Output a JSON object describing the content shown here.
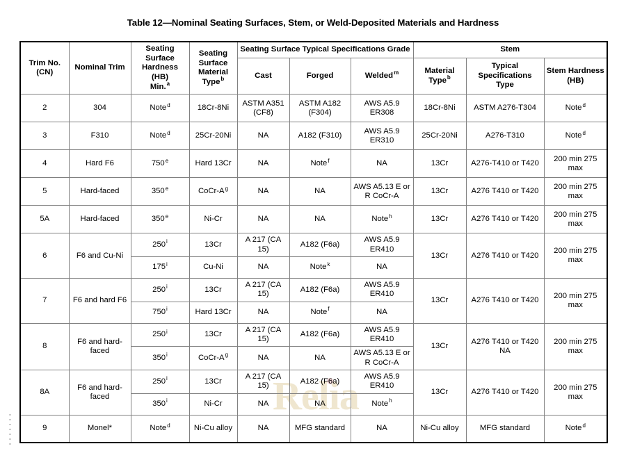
{
  "document": {
    "title": "Table 12—Nominal Seating Surfaces, Stem, or Weld-Deposited Materials and Hardness",
    "watermark": "Relia"
  },
  "table": {
    "header": {
      "group_seating_surface_specs": "Seating Surface Typical Specifications Grade",
      "group_stem": "Stem",
      "trim_no": "Trim No. (CN)",
      "trim_no_line1": "Trim No.",
      "trim_no_line2": "(CN)",
      "nominal_trim": "Nominal Trim",
      "seating_hardness_line1": "Seating",
      "seating_hardness_line2": "Surface",
      "seating_hardness_line3": "Hardness (HB)",
      "seating_hardness_line4": "Min.",
      "seating_hardness_sup": "a",
      "seating_material_line1": "Seating",
      "seating_material_line2": "Surface",
      "seating_material_line3": "Material",
      "seating_material_line4": "Type",
      "seating_material_sup": "b",
      "cast": "Cast",
      "forged": "Forged",
      "welded": "Welded",
      "welded_sup": "m",
      "stem_material_line1": "Material",
      "stem_material_line2": "Type",
      "stem_material_sup": "b",
      "stem_typical_line1": "Typical",
      "stem_typical_line2": "Specifications",
      "stem_typical_line3": "Type",
      "stem_hardness_line1": "Stem Hardness",
      "stem_hardness_line2": "(HB)"
    },
    "rows": [
      {
        "trim_no": "2",
        "nominal_trim": "304",
        "hardness": "Note",
        "hardness_sup": "d",
        "material": "18Cr-8Ni",
        "cast": "ASTM A351 (CF8)",
        "forged": "ASTM A182 (F304)",
        "welded": "AWS A5.9 ER308",
        "stem_material": "18Cr-8Ni",
        "stem_spec": "ASTM A276-T304",
        "stem_hardness": "Note",
        "stem_hardness_sup": "d"
      },
      {
        "trim_no": "3",
        "nominal_trim": "F310",
        "hardness": "Note",
        "hardness_sup": "d",
        "material": "25Cr-20Ni",
        "cast": "NA",
        "forged": "A182 (F310)",
        "welded": "AWS A5.9 ER310",
        "stem_material": "25Cr-20Ni",
        "stem_spec": "A276-T310",
        "stem_hardness": "Note",
        "stem_hardness_sup": "d"
      },
      {
        "trim_no": "4",
        "nominal_trim": "Hard F6",
        "hardness": "750",
        "hardness_sup": "e",
        "material": "Hard 13Cr",
        "cast": "NA",
        "forged": "Note",
        "forged_sup": "f",
        "welded": "NA",
        "stem_material": "13Cr",
        "stem_spec": "A276-T410 or T420",
        "stem_hardness": "200 min 275 max"
      },
      {
        "trim_no": "5",
        "nominal_trim": "Hard-faced",
        "hardness": "350",
        "hardness_sup": "e",
        "material": "CoCr-A",
        "material_sup": "g",
        "cast": "NA",
        "forged": "NA",
        "welded": "AWS A5.13 E or R CoCr-A",
        "stem_material": "13Cr",
        "stem_spec": "A276 T410 or T420",
        "stem_hardness": "200 min 275 max"
      },
      {
        "trim_no": "5A",
        "nominal_trim": "Hard-faced",
        "hardness": "350",
        "hardness_sup": "e",
        "material": "Ni-Cr",
        "cast": "NA",
        "forged": "NA",
        "welded": "Note",
        "welded_sup": "h",
        "stem_material": "13Cr",
        "stem_spec": "A276 T410 or T420",
        "stem_hardness": "200 min 275 max"
      },
      {
        "trim_no": "6",
        "nominal_trim": "F6 and Cu-Ni",
        "stem_material": "13Cr",
        "stem_spec": "A276 T410 or T420",
        "stem_hardness": "200 min 275 max",
        "subrows": [
          {
            "hardness": "250",
            "hardness_sup": "i",
            "material": "13Cr",
            "cast": "A 217 (CA 15)",
            "forged": "A182 (F6a)",
            "welded": "AWS A5.9 ER410"
          },
          {
            "hardness": "175",
            "hardness_sup": "i",
            "material": "Cu-Ni",
            "cast": "NA",
            "forged": "Note",
            "forged_sup": "k",
            "welded": "NA"
          }
        ]
      },
      {
        "trim_no": "7",
        "nominal_trim": "F6 and hard F6",
        "stem_material": "13Cr",
        "stem_spec": "A276 T410 or T420",
        "stem_hardness": "200 min 275 max",
        "subrows": [
          {
            "hardness": "250",
            "hardness_sup": "i",
            "material": "13Cr",
            "cast": "A 217 (CA 15)",
            "forged": "A182 (F6a)",
            "welded": "AWS A5.9 ER410"
          },
          {
            "hardness": "750",
            "hardness_sup": "i",
            "material": "Hard 13Cr",
            "cast": "NA",
            "forged": "Note",
            "forged_sup": "f",
            "welded": "NA"
          }
        ]
      },
      {
        "trim_no": "8",
        "nominal_trim": "F6 and hard-faced",
        "stem_material": "13Cr",
        "stem_spec": "A276 T410 or T420 NA",
        "stem_hardness": "200 min 275 max",
        "subrows": [
          {
            "hardness": "250",
            "hardness_sup": "i",
            "material": "13Cr",
            "cast": "A 217 (CA 15)",
            "forged": "A182 (F6a)",
            "welded": "AWS A5.9 ER410"
          },
          {
            "hardness": "350",
            "hardness_sup": "i",
            "material": "CoCr-A",
            "material_sup": "g",
            "cast": "NA",
            "forged": "NA",
            "welded": "AWS A5.13 E or R CoCr-A"
          }
        ]
      },
      {
        "trim_no": "8A",
        "nominal_trim": "F6 and hard-faced",
        "stem_material": "13Cr",
        "stem_spec": "A276 T410 or T420",
        "stem_hardness": "200 min 275 max",
        "subrows": [
          {
            "hardness": "250",
            "hardness_sup": "i",
            "material": "13Cr",
            "cast": "A 217 (CA 15)",
            "forged": "A182 (F6a)",
            "welded": "AWS A5.9 ER410"
          },
          {
            "hardness": "350",
            "hardness_sup": "i",
            "material": "Ni-Cr",
            "cast": "NA",
            "forged": "NA",
            "welded": "Note",
            "welded_sup": "h"
          }
        ]
      },
      {
        "trim_no": "9",
        "nominal_trim": "Monel*",
        "hardness": "Note",
        "hardness_sup": "d",
        "material": "Ni-Cu alloy",
        "cast": "NA",
        "forged": "MFG standard",
        "welded": "NA",
        "stem_material": "Ni-Cu alloy",
        "stem_spec": "MFG standard",
        "stem_hardness": "Note",
        "stem_hardness_sup": "d"
      }
    ]
  }
}
